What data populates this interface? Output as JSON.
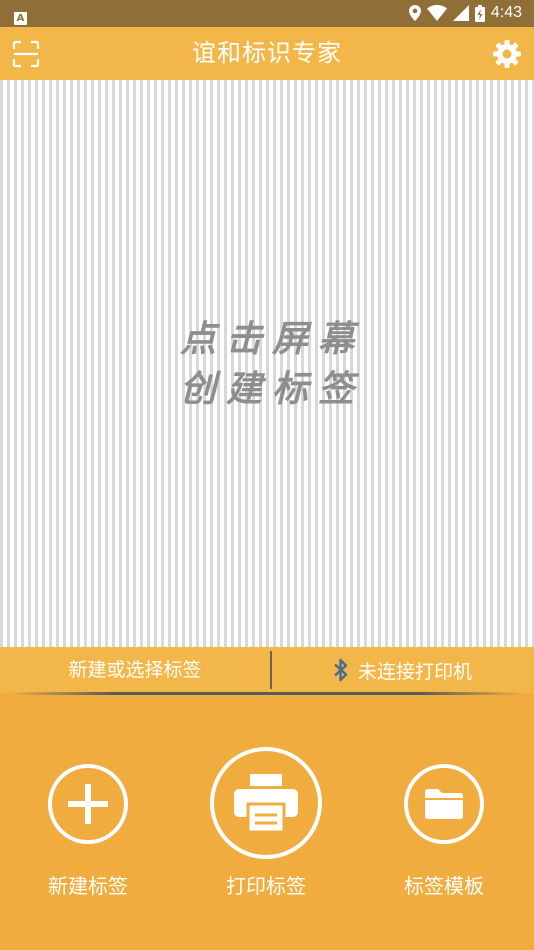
{
  "status_bar": {
    "time": "4:43",
    "notification_badge": "A",
    "icons": [
      "location-icon",
      "wifi-icon",
      "signal-icon",
      "battery-charging-icon"
    ]
  },
  "app_bar": {
    "title": "谊和标识专家",
    "left_icon": "scan-icon",
    "right_icon": "gear-icon"
  },
  "canvas": {
    "hint_line1": "点击屏幕",
    "hint_line2": "创建标签"
  },
  "info_bar": {
    "label_status": "新建或选择标签",
    "printer_status": "未连接打印机",
    "printer_icon": "bluetooth-icon"
  },
  "actions": [
    {
      "label": "新建标签",
      "icon": "plus-icon"
    },
    {
      "label": "打印标签",
      "icon": "printer-icon"
    },
    {
      "label": "标签模板",
      "icon": "folder-icon"
    }
  ],
  "colors": {
    "primary": "#f3b749",
    "bottom_panel": "#f1ac3f",
    "status_bar": "#8f6f37",
    "hint_text": "#8e8e8e",
    "bluetooth": "#4a6c8c"
  }
}
